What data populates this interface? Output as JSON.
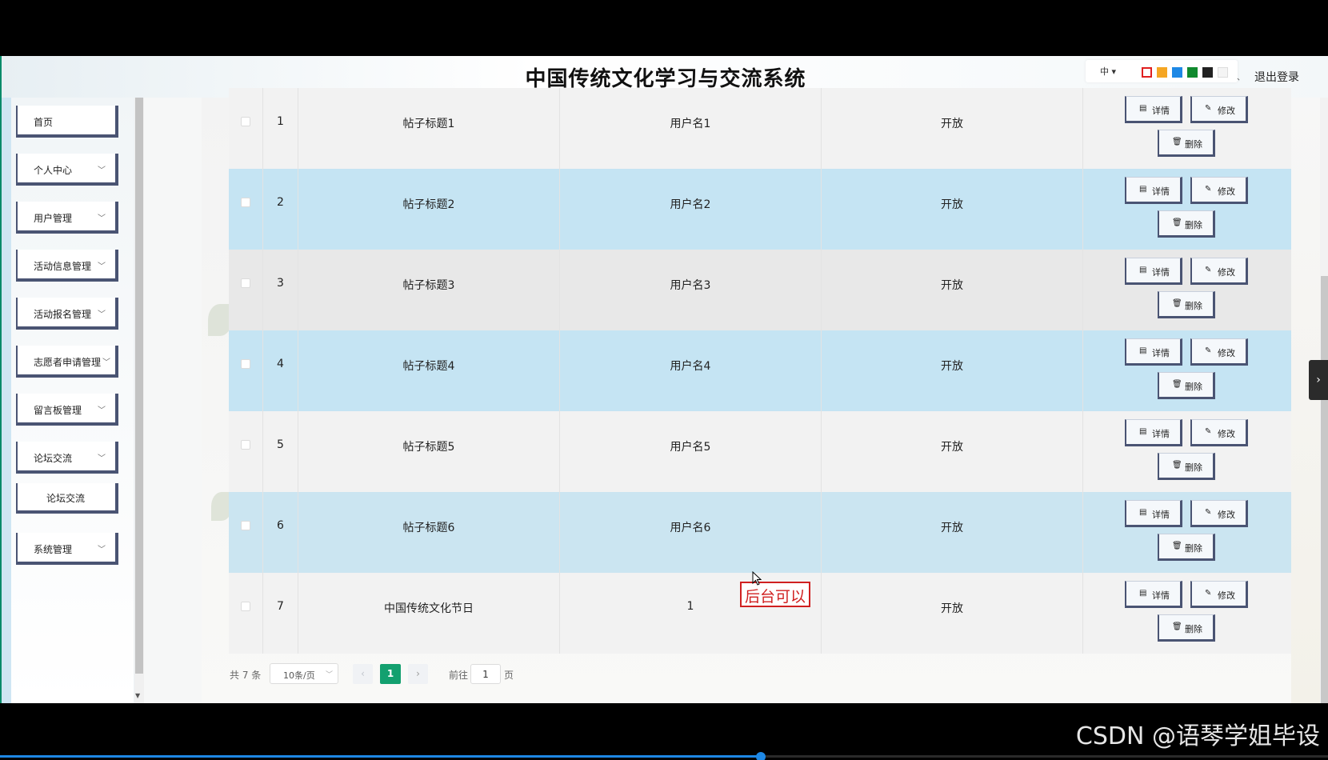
{
  "header": {
    "title": "中国传统文化学习与交流系统",
    "lang": "中 ▾",
    "logout": "退出登录",
    "swatches": [
      "#e02020",
      "#f5a623",
      "#1e88e5",
      "#108a2e",
      "#222222",
      "#f4f4f4"
    ]
  },
  "sidebar": {
    "items": [
      {
        "label": "首页",
        "chevron": ""
      },
      {
        "label": "个人中心",
        "chevron": "﹀"
      },
      {
        "label": "用户管理",
        "chevron": "﹀"
      },
      {
        "label": "活动信息管理",
        "chevron": "﹀"
      },
      {
        "label": "活动报名管理",
        "chevron": "﹀"
      },
      {
        "label": "志愿者申请管理",
        "chevron": "﹀"
      },
      {
        "label": "留言板管理",
        "chevron": "﹀"
      },
      {
        "label": "论坛交流",
        "chevron": "﹀"
      },
      {
        "label": "论坛交流",
        "chevron": ""
      },
      {
        "label": "系统管理",
        "chevron": "﹀"
      }
    ]
  },
  "table": {
    "rows": [
      {
        "index": "1",
        "title": "帖子标题1",
        "user": "用户名1",
        "status": "开放"
      },
      {
        "index": "2",
        "title": "帖子标题2",
        "user": "用户名2",
        "status": "开放"
      },
      {
        "index": "3",
        "title": "帖子标题3",
        "user": "用户名3",
        "status": "开放"
      },
      {
        "index": "4",
        "title": "帖子标题4",
        "user": "用户名4",
        "status": "开放"
      },
      {
        "index": "5",
        "title": "帖子标题5",
        "user": "用户名5",
        "status": "开放"
      },
      {
        "index": "6",
        "title": "帖子标题6",
        "user": "用户名6",
        "status": "开放"
      },
      {
        "index": "7",
        "title": "中国传统文化节日",
        "user": "1",
        "status": "开放"
      }
    ],
    "actions": {
      "detail": "详情",
      "edit": "修改",
      "delete": "删除"
    }
  },
  "pagination": {
    "total": "共 7 条",
    "page_size": "10条/页",
    "prev": "‹",
    "current_page": "1",
    "next": "›",
    "goto_label": "前往",
    "goto_value": "1",
    "goto_unit": "页"
  },
  "overlay": {
    "annotation": "后台可以"
  },
  "watermark": "CSDN @语琴学姐毕设",
  "player": {
    "progress": 0.573
  }
}
